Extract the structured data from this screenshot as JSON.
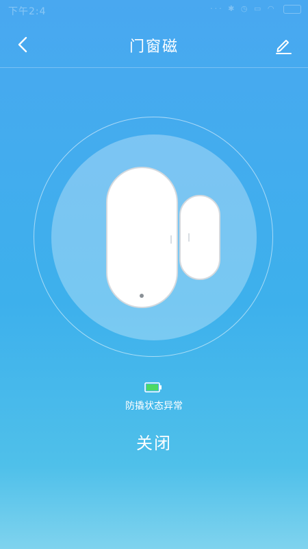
{
  "status_bar": {
    "time": "下午2:4",
    "icons": [
      "signal-icon",
      "bluetooth-icon",
      "alarm-icon",
      "message-icon",
      "wifi-icon",
      "battery-icon"
    ]
  },
  "header": {
    "title": "门窗磁",
    "back_icon": "chevron-left-icon",
    "edit_icon": "pencil-icon"
  },
  "device": {
    "name_icon": "door-window-sensor-icon",
    "battery_color": "#4cd964",
    "tamper_status": "防撬状态异常",
    "state": "关闭"
  },
  "colors": {
    "background_top": "#49a8f0",
    "background_bottom": "#7fd3ee",
    "accent": "#ffffff"
  }
}
